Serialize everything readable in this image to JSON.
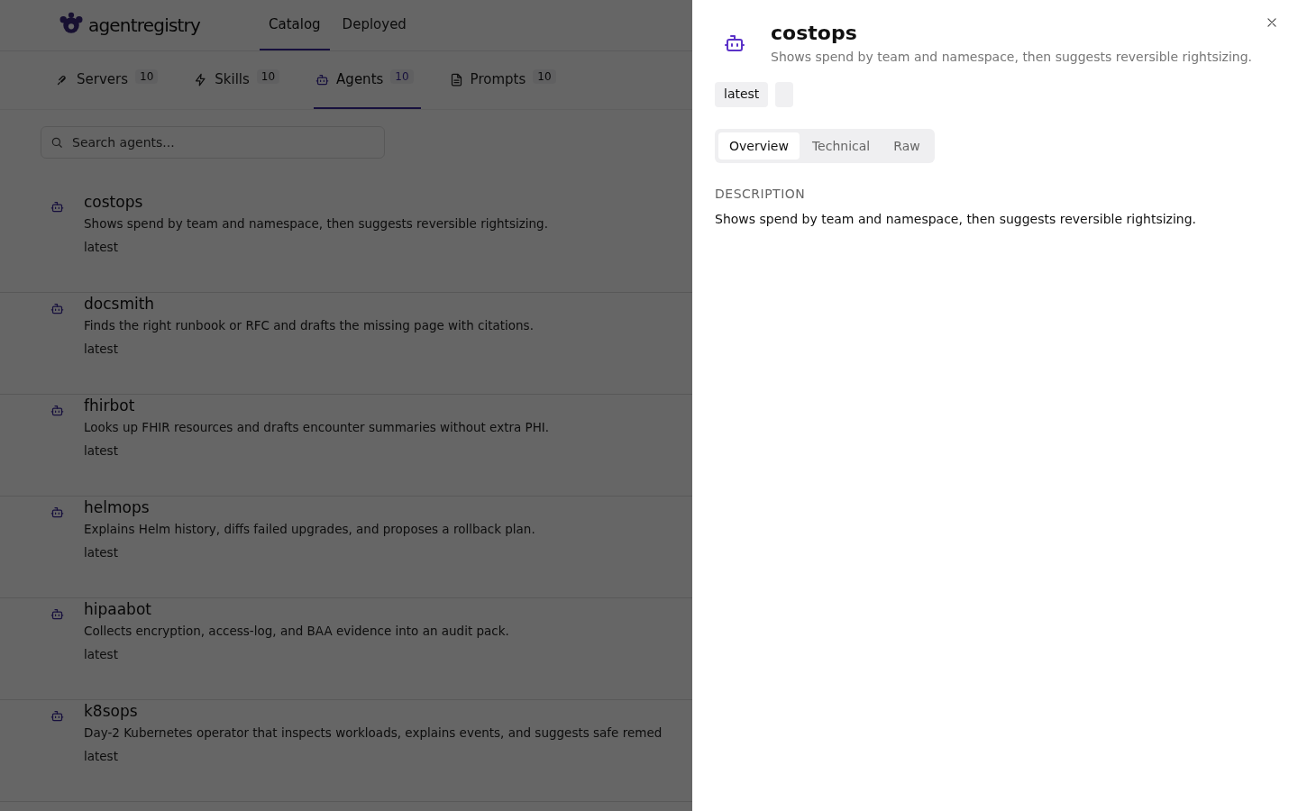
{
  "header": {
    "logo": "agentregistry",
    "nav": [
      {
        "label": "Catalog",
        "selected": true
      },
      {
        "label": "Deployed",
        "selected": false
      }
    ]
  },
  "category_tabs": [
    {
      "kind": "servers",
      "label": "Servers",
      "count": "10",
      "selected": false
    },
    {
      "kind": "skills",
      "label": "Skills",
      "count": "10",
      "selected": false
    },
    {
      "kind": "agents",
      "label": "Agents",
      "count": "10",
      "selected": true
    },
    {
      "kind": "prompts",
      "label": "Prompts",
      "count": "10",
      "selected": false
    }
  ],
  "search": {
    "placeholder": "Search agents..."
  },
  "agents": [
    {
      "name": "costops",
      "description": "Shows spend by team and namespace, then suggests reversible rightsizing.",
      "version": "latest"
    },
    {
      "name": "docsmith",
      "description": "Finds the right runbook or RFC and drafts the missing page with citations.",
      "version": "latest"
    },
    {
      "name": "fhirbot",
      "description": "Looks up FHIR resources and drafts encounter summaries without extra PHI.",
      "version": "latest"
    },
    {
      "name": "helmops",
      "description": "Explains Helm history, diffs failed upgrades, and proposes a rollback plan.",
      "version": "latest"
    },
    {
      "name": "hipaabot",
      "description": "Collects encryption, access-log, and BAA evidence into an audit pack.",
      "version": "latest"
    },
    {
      "name": "k8sops",
      "description": "Day-2 Kubernetes operator that inspects workloads, explains events, and suggests safe remed",
      "version": "latest"
    }
  ],
  "detail_panel": {
    "title": "costops",
    "subtitle": "Shows spend by team and namespace, then suggests reversible rightsizing.",
    "tags": [
      "latest"
    ],
    "tabs": [
      {
        "label": "Overview",
        "selected": true
      },
      {
        "label": "Technical",
        "selected": false
      },
      {
        "label": "Raw",
        "selected": false
      }
    ],
    "section_label": "DESCRIPTION",
    "description": "Shows spend by team and namespace, then suggests reversible rightsizing."
  }
}
